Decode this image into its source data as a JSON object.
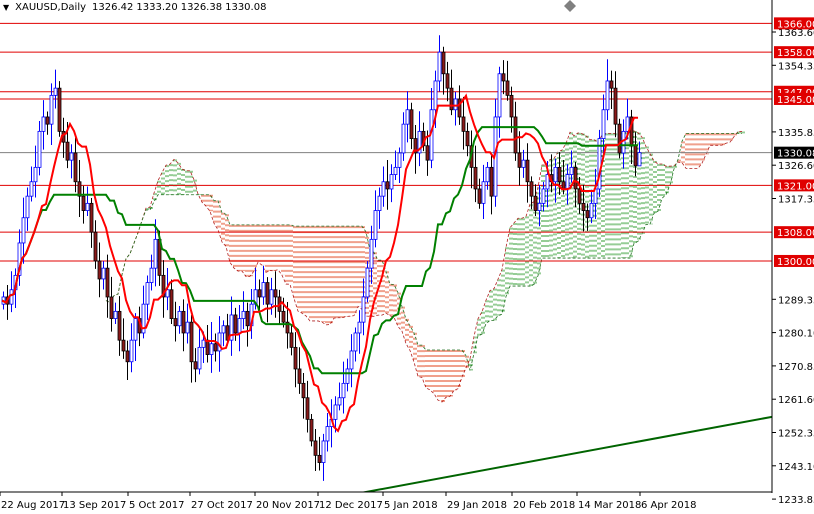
{
  "header": {
    "symbol": "XAUUSD,Daily",
    "open": "1326.42",
    "high": "1333.20",
    "low": "1326.38",
    "close": "1330.08"
  },
  "colors": {
    "bull": "#0000ff",
    "bear_fill": "#8b1a1a",
    "bear_outline": "#000000",
    "tenkan": "#ff0000",
    "kijun": "#008000",
    "cloud_up": "#2e9b2e",
    "cloud_down": "#e0401a",
    "level": "#e00000",
    "current": "#808080",
    "trendline": "#006400"
  },
  "chart_data": {
    "type": "candlestick",
    "title": "XAUUSD,Daily",
    "indicator": "Ichimoku Kinko Hyo",
    "ylim": [
      1233.85,
      1366.0
    ],
    "y_ticks": [
      "1363.60",
      "1354.35",
      "1335.85",
      "1326.60",
      "1317.35",
      "1289.35",
      "1280.10",
      "1270.85",
      "1261.60",
      "1252.35",
      "1243.10",
      "1233.85"
    ],
    "x_ticks": [
      "22 Aug 2017",
      "13 Sep 2017",
      "5 Oct 2017",
      "27 Oct 2017",
      "20 Nov 2017",
      "12 Dec 2017",
      "5 Jan 2018",
      "29 Jan 2018",
      "20 Feb 2018",
      "14 Mar 2018",
      "6 Apr 2018"
    ],
    "x_tick_bar_index": [
      5,
      21,
      37,
      53,
      69,
      85,
      101,
      117,
      133,
      149,
      165
    ],
    "closes": [
      1290,
      1288,
      1292,
      1296,
      1305,
      1312,
      1318,
      1322,
      1326,
      1336,
      1340,
      1338,
      1346,
      1348,
      1336,
      1333,
      1328,
      1330,
      1322,
      1318,
      1314,
      1316,
      1308,
      1300,
      1295,
      1298,
      1290,
      1284,
      1286,
      1278,
      1275,
      1272,
      1278,
      1284,
      1280,
      1288,
      1294,
      1298,
      1306,
      1296,
      1290,
      1292,
      1284,
      1282,
      1286,
      1280,
      1283,
      1272,
      1270,
      1276,
      1278,
      1274,
      1277,
      1275,
      1280,
      1282,
      1278,
      1285,
      1280,
      1284,
      1286,
      1282,
      1288,
      1292,
      1290,
      1294,
      1288,
      1292,
      1290,
      1286,
      1283,
      1280,
      1276,
      1270,
      1266,
      1262,
      1256,
      1250,
      1246,
      1244,
      1250,
      1254,
      1256,
      1260,
      1262,
      1266,
      1270,
      1275,
      1280,
      1283,
      1290,
      1298,
      1306,
      1314,
      1318,
      1322,
      1320,
      1324,
      1326,
      1330,
      1338,
      1342,
      1334,
      1330,
      1336,
      1332,
      1328,
      1342,
      1350,
      1358,
      1352,
      1348,
      1342,
      1345,
      1340,
      1336,
      1332,
      1326,
      1320,
      1316,
      1322,
      1326,
      1318,
      1340,
      1352,
      1350,
      1346,
      1340,
      1330,
      1326,
      1328,
      1322,
      1318,
      1314,
      1316,
      1320,
      1324,
      1322,
      1326,
      1322,
      1320,
      1324,
      1326,
      1320,
      1316,
      1314,
      1312,
      1316,
      1320,
      1334,
      1342,
      1350,
      1348,
      1338,
      1330,
      1336,
      1340,
      1332,
      1326.42,
      1330.08
    ],
    "last_bar": {
      "open": 1326.42,
      "high": 1333.2,
      "low": 1326.38,
      "close": 1330.08
    },
    "levels": [
      "1366.00",
      "1358.00",
      "1347.00",
      "1345.00",
      "1321.00",
      "1308.00",
      "1300.00"
    ],
    "current_price": "1330.08",
    "trendline": {
      "start_price": 1235.0,
      "end_price": 1256.7
    }
  }
}
